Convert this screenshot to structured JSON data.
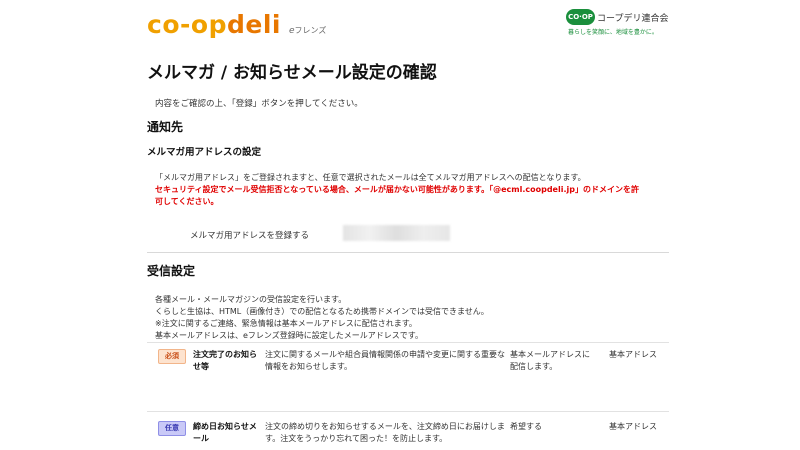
{
  "header": {
    "logo_co": "co",
    "logo_dash": "-",
    "logo_op": "op",
    "logo_deli": "deli",
    "logo_sub_e": "e",
    "logo_sub_text": "フレンズ",
    "coop_badge": "CO·OP",
    "coop_name": "コープデリ連合会",
    "coop_tagline": "暮らしを笑顔に、地域を豊かに。"
  },
  "page": {
    "title": "メルマガ / お知らせメール設定の確認",
    "intro": "内容をご確認の上、「登録」ボタンを押してください。"
  },
  "notify": {
    "heading": "通知先",
    "subheading": "メルマガ用アドレスの設定",
    "note": "「メルマガ用アドレス」をご登録されますと、任意で選択されたメールは全てメルマガ用アドレスへの配信となります。",
    "warning_line1": "セキュリティ設定でメール受信拒否となっている場合、メールが届かない可能性があります。「@ecml.coopdeli.jp」のドメインを許",
    "warning_line2": "可してください。",
    "address_label": "メルマガ用アドレスを登録する"
  },
  "receive": {
    "heading": "受信設定",
    "desc": [
      "各種メール・メールマガジンの受信設定を行います。",
      "くらしと生協は、HTML（画像付き）での配信となるため携帯ドメインでは受信できません。",
      "※注文に関するご連絡、緊急情報は基本メールアドレスに配信されます。",
      "基本メールアドレスは、eフレンズ登録時に設定したメールアドレスです。"
    ],
    "rows": [
      {
        "badge": "必須",
        "name_line1": "注文完了のお知ら",
        "name_line2": "せ等",
        "desc_line1": "注文に関するメールや組合員情報関係の申請や変更に関する重要な",
        "desc_line2": "情報をお知らせします。",
        "setting_line1": "基本メールアドレスに",
        "setting_line2": "配信します。",
        "address": "基本アドレス"
      },
      {
        "badge": "任意",
        "name_line1": "締め日お知らせメ",
        "name_line2": "ール",
        "desc_line1": "注文の締め切りをお知らせするメールを、注文締め日にお届けしま",
        "desc_line2": "す。注文をうっかり忘れて困った！を防止します。",
        "setting_line1": "希望する",
        "setting_line2": "",
        "address": "基本アドレス"
      }
    ]
  },
  "colors": {
    "logo_orange": "#f0a000",
    "logo_deep_orange": "#e87700",
    "coop_green": "#1a8f3c",
    "warning_red": "#e00000",
    "required_badge_bg": "#fde3cf",
    "optional_badge_bg": "#c9c9f7"
  }
}
